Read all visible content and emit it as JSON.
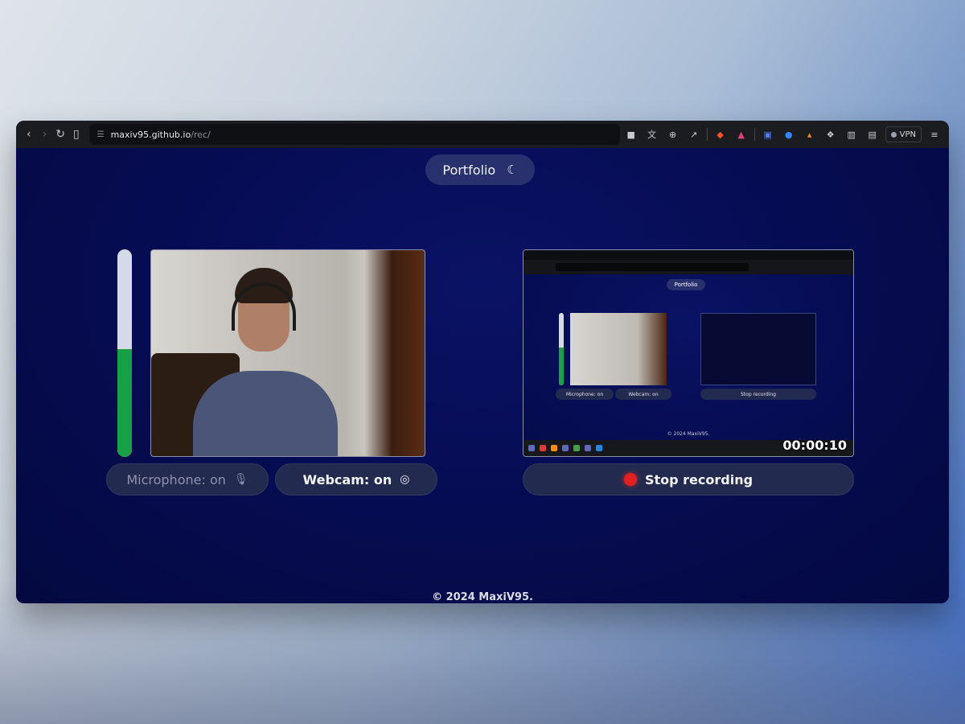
{
  "browser": {
    "url_host": "maxiv95.github.io",
    "url_path": "/rec/",
    "vpn_label": "VPN",
    "toolbar_icons": [
      "camera-icon",
      "translate-icon",
      "zoom-icon",
      "share-icon",
      "brave-shield-icon",
      "rewards-icon",
      "bitwarden-icon",
      "extension-icon",
      "metamask-icon",
      "puzzle-icon",
      "sidebar-icon",
      "wallet-icon",
      "menu-icon"
    ]
  },
  "header": {
    "portfolio_label": "Portfolio",
    "theme_icon": "moon-icon"
  },
  "webcam_panel": {
    "mic_level": 0.52,
    "level_color": "#17a045",
    "microphone_label": "Microphone: on",
    "webcam_label": "Webcam: on"
  },
  "recording_panel": {
    "timer": "00:00:10",
    "stop_label": "Stop recording",
    "record_dot_color": "#e41f1f",
    "mini": {
      "portfolio_label": "Portfolio",
      "microphone_label": "Microphone: on",
      "webcam_label": "Webcam: on",
      "stop_label": "Stop recording",
      "footer": "© 2024 MaxiV95."
    }
  },
  "footer": {
    "copyright": "© 2024 MaxiV95."
  },
  "colors": {
    "page_bg": "#060c52",
    "button_bg": "#232a4f",
    "accent_green": "#17a045"
  }
}
